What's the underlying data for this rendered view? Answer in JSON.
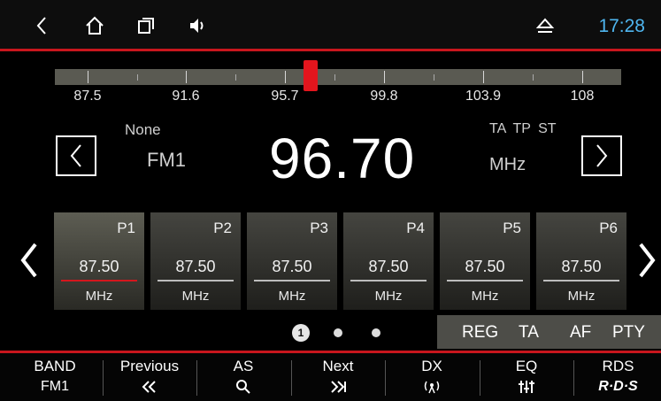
{
  "status_bar": {
    "time": "17:28",
    "time_color": "#4fb6f0",
    "icons": [
      "back-icon",
      "home-icon",
      "recent-apps-icon",
      "volume-icon",
      "eject-icon"
    ]
  },
  "tuner": {
    "scale_labels": [
      "87.5",
      "91.6",
      "95.7",
      "99.8",
      "103.9",
      "108"
    ],
    "needle_position_mhz": 96.7,
    "ps_name": "None",
    "band": "FM1",
    "frequency": "96.70",
    "flags": "TA TP ST",
    "unit": "MHz"
  },
  "presets": [
    {
      "name": "P1",
      "freq": "87.50",
      "unit": "MHz",
      "active": true
    },
    {
      "name": "P2",
      "freq": "87.50",
      "unit": "MHz",
      "active": false
    },
    {
      "name": "P3",
      "freq": "87.50",
      "unit": "MHz",
      "active": false
    },
    {
      "name": "P4",
      "freq": "87.50",
      "unit": "MHz",
      "active": false
    },
    {
      "name": "P5",
      "freq": "87.50",
      "unit": "MHz",
      "active": false
    },
    {
      "name": "P6",
      "freq": "87.50",
      "unit": "MHz",
      "active": false
    }
  ],
  "pagination": {
    "current": "1",
    "pages": 3
  },
  "options": [
    "REG",
    "TA",
    "AF",
    "PTY"
  ],
  "bottom_bar": [
    {
      "label": "BAND",
      "sub": "FM1",
      "icon": ""
    },
    {
      "label": "Previous",
      "sub": "",
      "icon": "previous-icon"
    },
    {
      "label": "AS",
      "sub": "",
      "icon": "search-icon"
    },
    {
      "label": "Next",
      "sub": "",
      "icon": "next-icon"
    },
    {
      "label": "DX",
      "sub": "",
      "icon": "antenna-icon"
    },
    {
      "label": "EQ",
      "sub": "",
      "icon": "equalizer-icon"
    },
    {
      "label": "RDS",
      "sub": "R·D·S",
      "icon": "rds-logo"
    }
  ],
  "colors": {
    "accent_red": "#c8161d",
    "needle_red": "#e3151d"
  }
}
